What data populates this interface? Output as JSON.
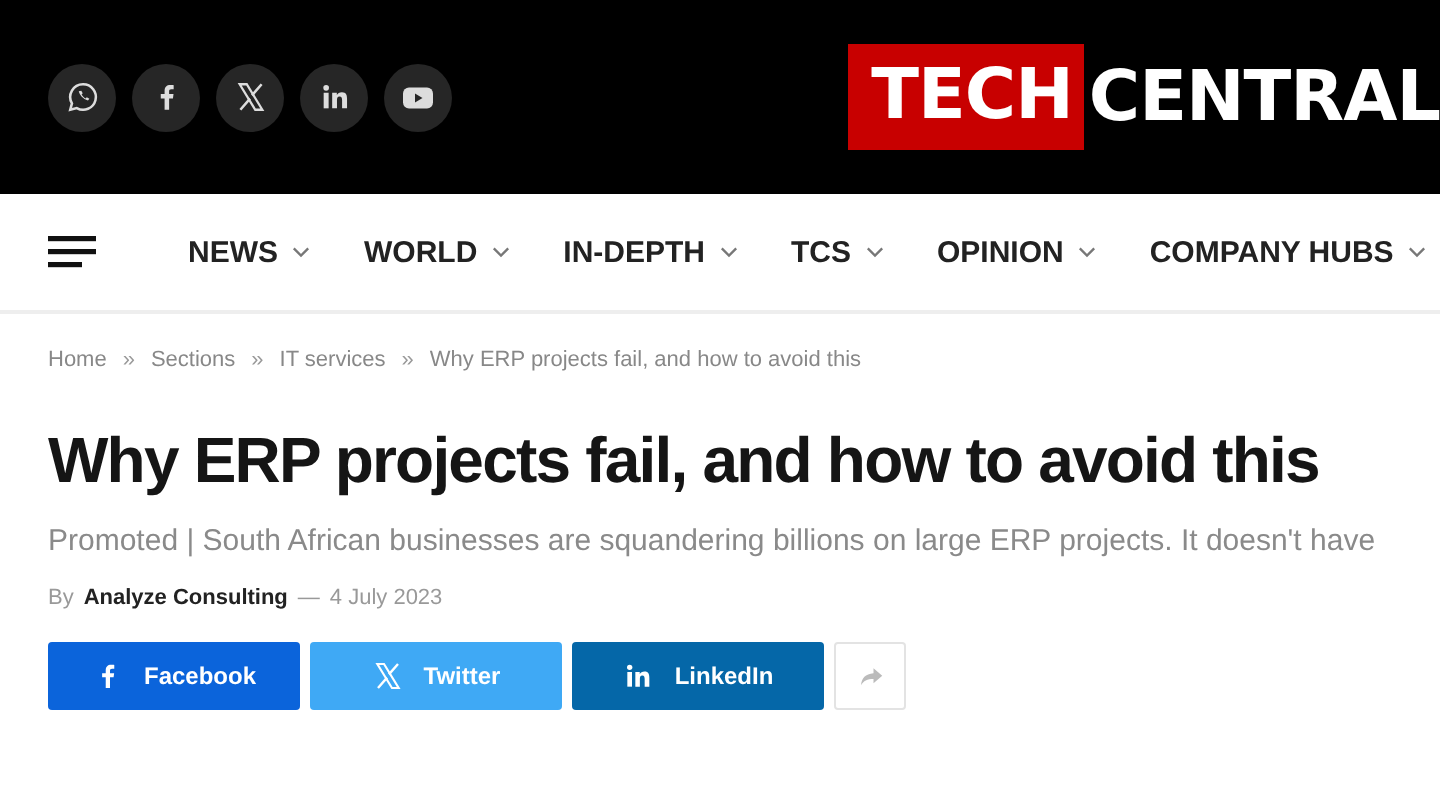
{
  "header": {
    "social_links": [
      {
        "kind": "whatsapp"
      },
      {
        "kind": "facebook"
      },
      {
        "kind": "x"
      },
      {
        "kind": "linkedin"
      },
      {
        "kind": "youtube"
      }
    ],
    "logo": {
      "highlight": "TECH",
      "rest": "CENTRAL"
    }
  },
  "nav": {
    "items": [
      {
        "label": "NEWS"
      },
      {
        "label": "WORLD"
      },
      {
        "label": "IN-DEPTH"
      },
      {
        "label": "TCS"
      },
      {
        "label": "OPINION"
      },
      {
        "label": "COMPANY HUBS"
      }
    ]
  },
  "breadcrumb": [
    "Home",
    "Sections",
    "IT services",
    "Why ERP projects fail, and how to avoid this"
  ],
  "breadcrumb_separator": "»",
  "article": {
    "title": "Why ERP projects fail, and how to avoid this",
    "dek": "Promoted | South African businesses are squandering billions on large ERP projects. It doesn't have",
    "byline_prefix": "By",
    "author": "Analyze Consulting",
    "date_separator": "—",
    "date": "4 July 2023"
  },
  "share_buttons": [
    {
      "kind": "facebook",
      "label": "Facebook"
    },
    {
      "kind": "twitter",
      "label": "Twitter"
    },
    {
      "kind": "linkedin",
      "label": "LinkedIn"
    },
    {
      "kind": "more"
    }
  ]
}
